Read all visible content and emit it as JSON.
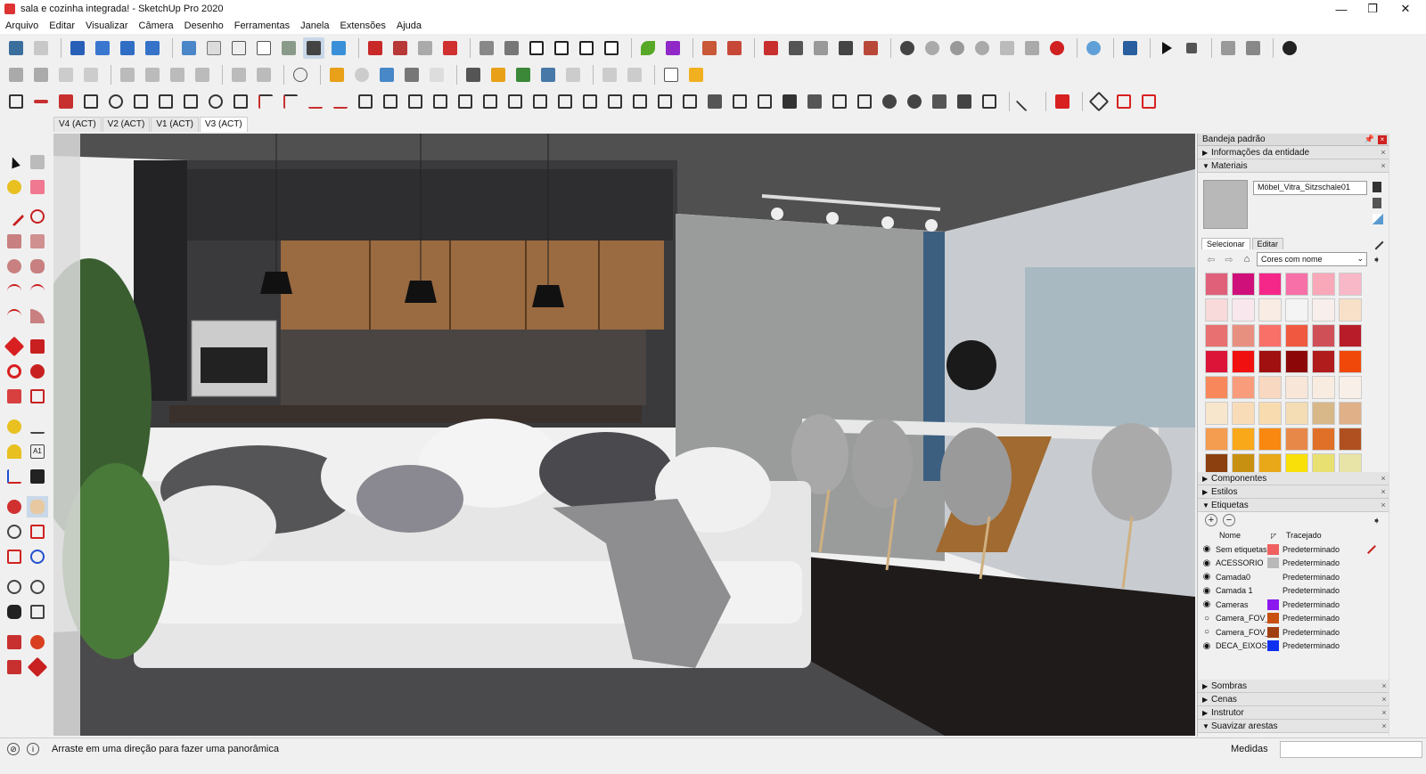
{
  "window": {
    "title": "sala e cozinha integrada! - SketchUp Pro 2020",
    "minimize": "—",
    "maximize": "❐",
    "close": "✕"
  },
  "menu": [
    "Arquivo",
    "Editar",
    "Visualizar",
    "Câmera",
    "Desenho",
    "Ferramentas",
    "Janela",
    "Extensões",
    "Ajuda"
  ],
  "scene_tabs": [
    {
      "label": "V4 (ACT)",
      "active": false
    },
    {
      "label": "V2 (ACT)",
      "active": false
    },
    {
      "label": "V1 (ACT)",
      "active": false
    },
    {
      "label": "V3 (ACT)",
      "active": true
    }
  ],
  "tray": {
    "title": "Bandeja padrão",
    "panels": {
      "entity_info": "Informações da entidade",
      "materials": "Materiais",
      "components": "Componentes",
      "styles": "Estilos",
      "tags": "Etiquetas",
      "shadows": "Sombras",
      "scenes": "Cenas",
      "instructor": "Instrutor",
      "soften_edges": "Suavizar arestas"
    },
    "materials": {
      "current_name": "Möbel_Vitra_Sitzschale01",
      "tab_select": "Selecionar",
      "tab_edit": "Editar",
      "collection": "Cores com nome",
      "swatches": [
        "#e0607a",
        "#d0107a",
        "#f5288a",
        "#f870a8",
        "#f8a8b8",
        "#f8b8c8",
        "#f8dada",
        "#f8e8ee",
        "#f8ece4",
        "#f4f4f4",
        "#f8eeec",
        "#f8e0c8",
        "#e87070",
        "#e89080",
        "#f87068",
        "#f05840",
        "#d05058",
        "#b81c28",
        "#dc1438",
        "#f01010",
        "#a01010",
        "#8c0808",
        "#b01c1c",
        "#f04808",
        "#f8885c",
        "#f89c7c",
        "#f8d8c0",
        "#f8e6d8",
        "#f8ece0",
        "#f8f0e8",
        "#f8e6cc",
        "#f8dcb8",
        "#f8dcb0",
        "#f4dcb4",
        "#d8b888",
        "#e0b088",
        "#f49c50",
        "#f8a818",
        "#f88810",
        "#e88848",
        "#e07028",
        "#b05020",
        "#8c4010",
        "#c89010",
        "#e8a818",
        "#f8e008",
        "#e8e070",
        "#e8e4a8"
      ]
    },
    "tags": {
      "col_name": "Nome",
      "col_dash": "Tracejado",
      "rows": [
        {
          "name": "Sem etiquetas",
          "color": "#f06060",
          "dash": "Predeterminado",
          "visible": true
        },
        {
          "name": "ACESSORIO",
          "color": "#b8b8b8",
          "dash": "Predeterminado",
          "visible": true
        },
        {
          "name": "Camada0",
          "color": "#f0f0f0",
          "dash": "Predeterminado",
          "visible": true
        },
        {
          "name": "Camada 1",
          "color": "#f0f0f0",
          "dash": "Predeterminado",
          "visible": true
        },
        {
          "name": "Cameras",
          "color": "#8c18f0",
          "dash": "Predeterminado",
          "visible": true
        },
        {
          "name": "Camera_FOV_",
          "color": "#c85010",
          "dash": "Predeterminado",
          "visible": false
        },
        {
          "name": "Camera_FOV_",
          "color": "#a04010",
          "dash": "Predeterminado",
          "visible": false
        },
        {
          "name": "DECA_EIXOS",
          "color": "#1030f0",
          "dash": "Predeterminado",
          "visible": true
        }
      ]
    }
  },
  "status": {
    "text": "Arraste em uma direção para fazer uma panorâmica",
    "measure_label": "Medidas"
  }
}
